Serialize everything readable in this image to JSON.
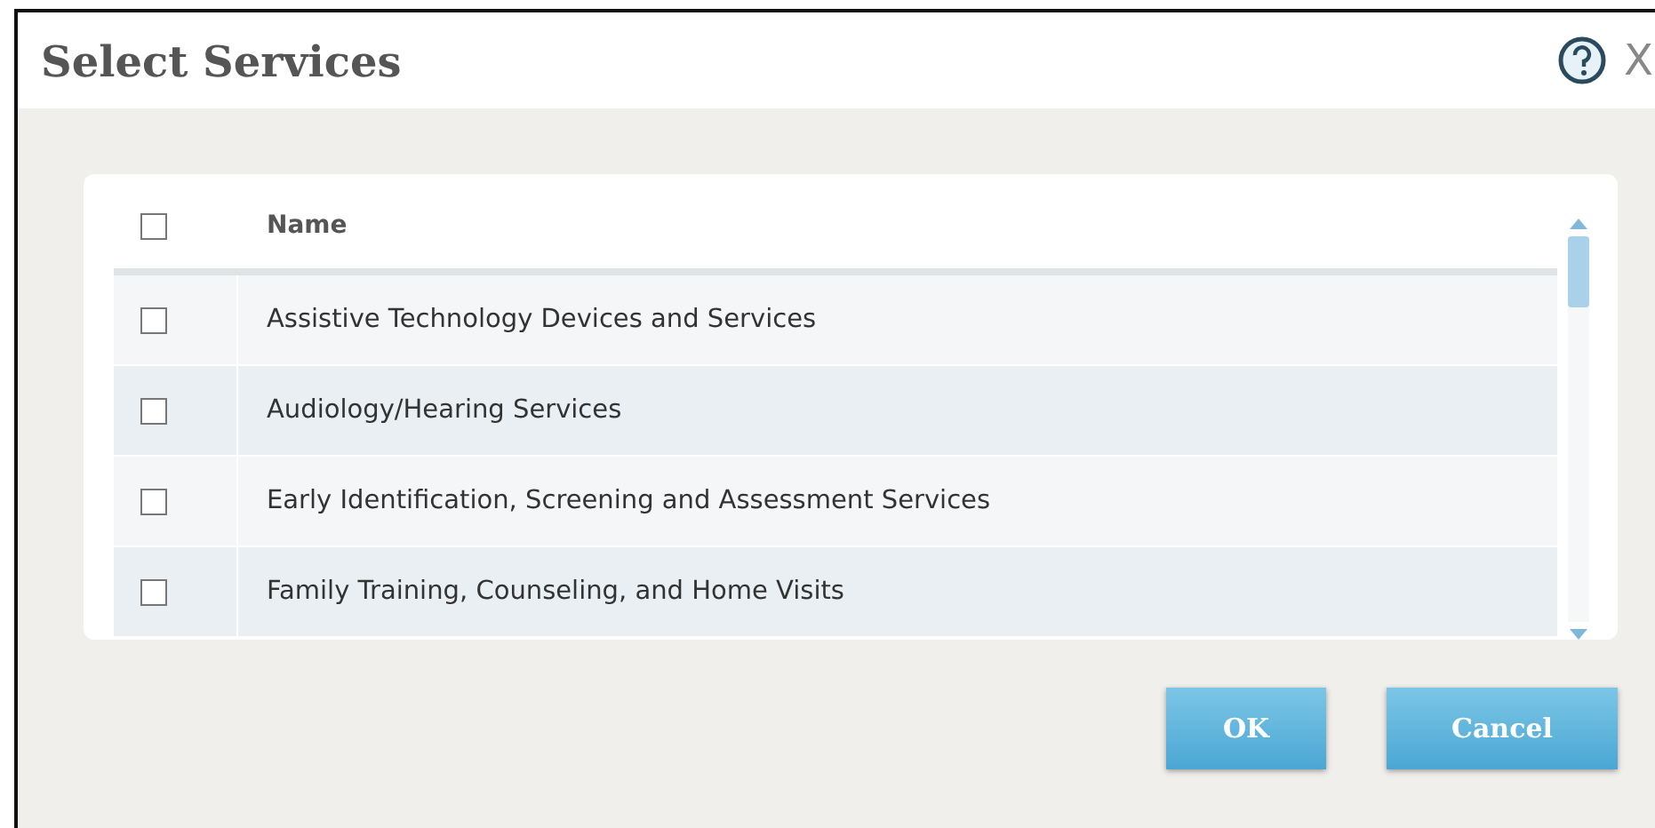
{
  "dialog": {
    "title": "Select Services",
    "close_label": "X"
  },
  "table": {
    "header": {
      "checked": false,
      "label": "Name"
    },
    "rows": [
      {
        "name": "Assistive Technology Devices and Services",
        "checked": false
      },
      {
        "name": "Audiology/Hearing Services",
        "checked": false
      },
      {
        "name": "Early Identification, Screening and Assessment Services",
        "checked": false
      },
      {
        "name": "Family Training, Counseling, and Home Visits",
        "checked": false
      }
    ]
  },
  "buttons": [
    "OK",
    "Cancel"
  ]
}
